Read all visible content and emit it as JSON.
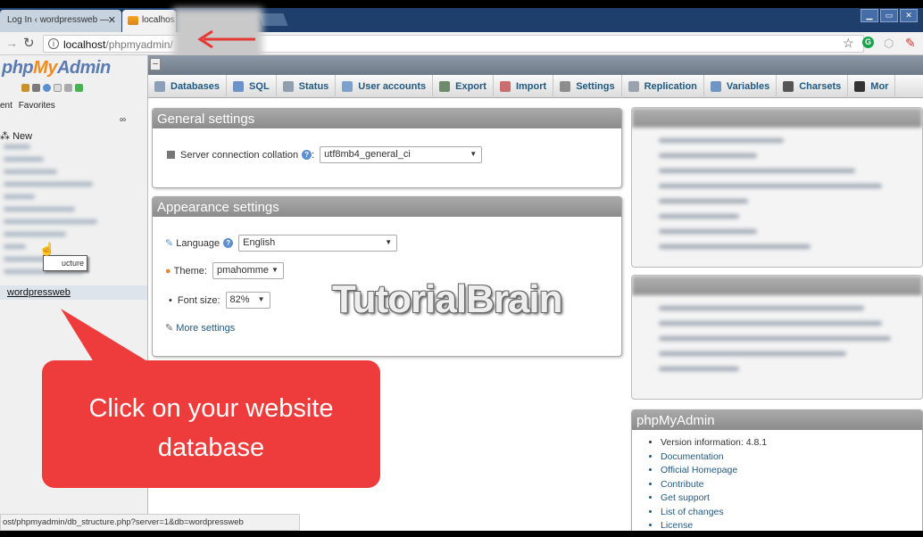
{
  "browser": {
    "tabs": [
      {
        "title": "Log In ‹ wordpressweb —",
        "close": "✕"
      },
      {
        "title": "localhos"
      }
    ],
    "window_controls": [
      "▁",
      "▭",
      "✕"
    ],
    "url_host": "localhost",
    "url_path": "/phpmyadmin/",
    "status_url": "ost/phpmyadmin/db_structure.php?server=1&db=wordpressweb"
  },
  "leftnav": {
    "logo_php": "php",
    "logo_my": "My",
    "logo_admin": "Admin",
    "tabs": [
      "ent",
      "Favorites"
    ],
    "new_label": "New",
    "selected_db": "wordpressweb",
    "tooltip": "ucture"
  },
  "topmenu": [
    {
      "label": "Databases",
      "icon": "databases-icon",
      "color": "#8aa0b8"
    },
    {
      "label": "SQL",
      "icon": "sql-icon",
      "color": "#6b93c9"
    },
    {
      "label": "Status",
      "icon": "status-icon",
      "color": "#8f9fb0"
    },
    {
      "label": "User accounts",
      "icon": "users-icon",
      "color": "#7ca1cc"
    },
    {
      "label": "Export",
      "icon": "export-icon",
      "color": "#6d8a6d"
    },
    {
      "label": "Import",
      "icon": "import-icon",
      "color": "#c86e6e"
    },
    {
      "label": "Settings",
      "icon": "wrench-icon",
      "color": "#8d8d8d"
    },
    {
      "label": "Replication",
      "icon": "replication-icon",
      "color": "#9aa3ad"
    },
    {
      "label": "Variables",
      "icon": "variables-icon",
      "color": "#6f95c7"
    },
    {
      "label": "Charsets",
      "icon": "charsets-icon",
      "color": "#555555"
    },
    {
      "label": "Mor",
      "icon": "more-icon",
      "color": "#333333"
    }
  ],
  "general": {
    "title": "General settings",
    "collation_label": "Server connection collation",
    "collation_value": "utf8mb4_general_ci"
  },
  "appearance": {
    "title": "Appearance settings",
    "language_label": "Language",
    "language_value": "English",
    "theme_label": "Theme:",
    "theme_value": "pmahomme",
    "font_label": "Font size:",
    "font_value": "82%",
    "more_settings": "More settings"
  },
  "watermark": "TutorialBrain",
  "pma_panel": {
    "title": "phpMyAdmin",
    "items": [
      "Version information: 4.8.1",
      "Documentation",
      "Official Homepage",
      "Contribute",
      "Get support",
      "List of changes",
      "License"
    ]
  },
  "callout": {
    "line1": "Click on your website",
    "line2": "database",
    "color": "#ee3b3b"
  }
}
